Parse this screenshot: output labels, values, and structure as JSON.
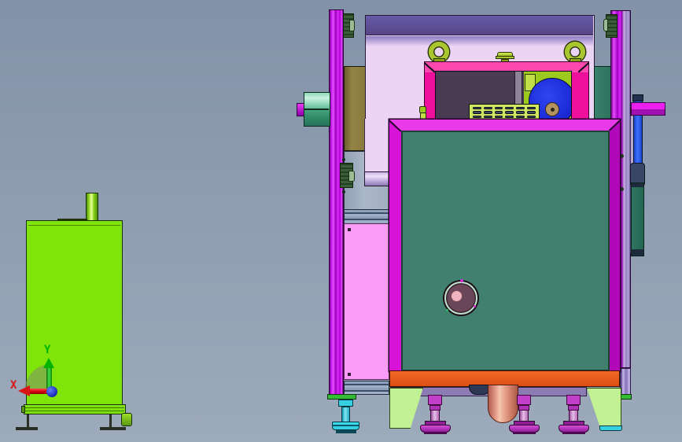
{
  "viewport": {
    "description": "CAD orthographic front view: large machine assembly (right) and separate green tank (left) on gradient backdrop",
    "view_name": "front"
  },
  "axis_triad": {
    "x_label": "X",
    "y_label": "Y",
    "x_color": "#d81616",
    "y_color": "#00b400",
    "origin_color": "#2133b8"
  },
  "vent_grille": {
    "rows": 3,
    "cols": 6
  },
  "parts": [
    {
      "name": "left-tank",
      "color": "#7ee409"
    },
    {
      "name": "tank-chimney",
      "color": "#9ade2a"
    },
    {
      "name": "tank-base-plate",
      "color": "#7ee409"
    },
    {
      "name": "frame-column-left",
      "color": "#c318e8"
    },
    {
      "name": "frame-column-right",
      "color": "#c318e8"
    },
    {
      "name": "top-cabinet",
      "color": "#ecd4f4"
    },
    {
      "name": "cabinet-top-band",
      "color": "#5a4b90"
    },
    {
      "name": "sight-window-frame",
      "color": "#ee0f9d"
    },
    {
      "name": "window-interior",
      "color": "#483b52"
    },
    {
      "name": "cooling-fan",
      "color": "#1f2fe0"
    },
    {
      "name": "vent-grille",
      "color": "#cfe761"
    },
    {
      "name": "lifting-eyebolt-left",
      "color": "#a9c72d"
    },
    {
      "name": "lifting-eyebolt-right",
      "color": "#a9c72d"
    },
    {
      "name": "front-door",
      "color": "#41806f"
    },
    {
      "name": "door-frame",
      "color": "#d613d6"
    },
    {
      "name": "door-handle",
      "color": "#6a4758"
    },
    {
      "name": "side-panel-pink",
      "color": "#fb9df8"
    },
    {
      "name": "side-panel-gray",
      "color": "#a7b2c2"
    },
    {
      "name": "khaki-panel",
      "color": "#8a7a3e"
    },
    {
      "name": "teal-side-panel",
      "color": "#2f755f"
    },
    {
      "name": "side-cylinder",
      "color": "#6cc39e"
    },
    {
      "name": "base-orange-beam",
      "color": "#e5551b"
    },
    {
      "name": "base-purple-beam",
      "color": "#8d7cb4"
    },
    {
      "name": "gusset-bracket-left",
      "color": "#c2f193"
    },
    {
      "name": "gusset-bracket-right",
      "color": "#c2f193"
    },
    {
      "name": "leveling-foot-cyan",
      "color": "#35d0e2"
    },
    {
      "name": "leveling-feet-magenta",
      "color": "#c33fc9"
    },
    {
      "name": "drain-pipe-elbow",
      "color": "#df9680"
    },
    {
      "name": "right-arm",
      "color": "#ea1ff0"
    },
    {
      "name": "right-blue-rail",
      "color": "#2a55e8"
    }
  ],
  "palette": {
    "bg_top": "#8292a8",
    "bg_bottom": "#9daabb",
    "tank_green": "#7ee409",
    "tank_outline": "#1c2f00",
    "tank_green_dark": "#5a9a10",
    "axis_x": "#d81616",
    "axis_y": "#00b400",
    "col_light": "#e74dff",
    "col_dark": "#70008a",
    "col_mid": "#a500c8",
    "col_violet": "#8f7fc0",
    "knob_dgreen": "#3a5f38",
    "knob_lgreen": "#9dbb95",
    "teal_cyl": "#6cc39e",
    "khaki": "#8a7a3e",
    "body_purple": "#5a4b90",
    "body_lavender": "#ecd4f4",
    "teal_side": "#2f755f",
    "blue_bar": "#2a55e8",
    "arm_magenta": "#ea1ff0",
    "arm_magenta_dark": "#a011b0",
    "slate": "#3a4666",
    "eyebolt": "#a9c72d",
    "eyebolt_dark": "#2a3306",
    "win_frame": "#ee0f9d",
    "win_frame_light": "#ff47b0",
    "win_interior": "#483b52",
    "win_strip": "#8d8498",
    "chartreuse": "#9ccb1e",
    "fan_blue": "#1f2fe0",
    "hub_tan": "#b39362",
    "grille_plate": "#cfe761",
    "grille_slot": "#3f4c64",
    "gray_panel": "#a7b2c2",
    "pink_panel": "#fb9df8",
    "door_frame": "#d613d6",
    "door_frame_light": "#e93ae9",
    "door_frame_dark": "#b007b7",
    "door_teal": "#41806f",
    "knob_face": "#6a4758",
    "knob_ring": "#bfe3d0",
    "knob_dot": "#f0b4c0",
    "orange": "#e5551b",
    "base_purple": "#8d7cb4",
    "bracket_green": "#c2f193",
    "cyan": "#35d0e2",
    "foot_magenta": "#c33fc9",
    "foot_dark": "#8d1f96",
    "pipe_light": "#f6c2ac",
    "pipe_dark": "#b06050",
    "navy": "#2c3854",
    "green_cap": "#33bb33"
  }
}
